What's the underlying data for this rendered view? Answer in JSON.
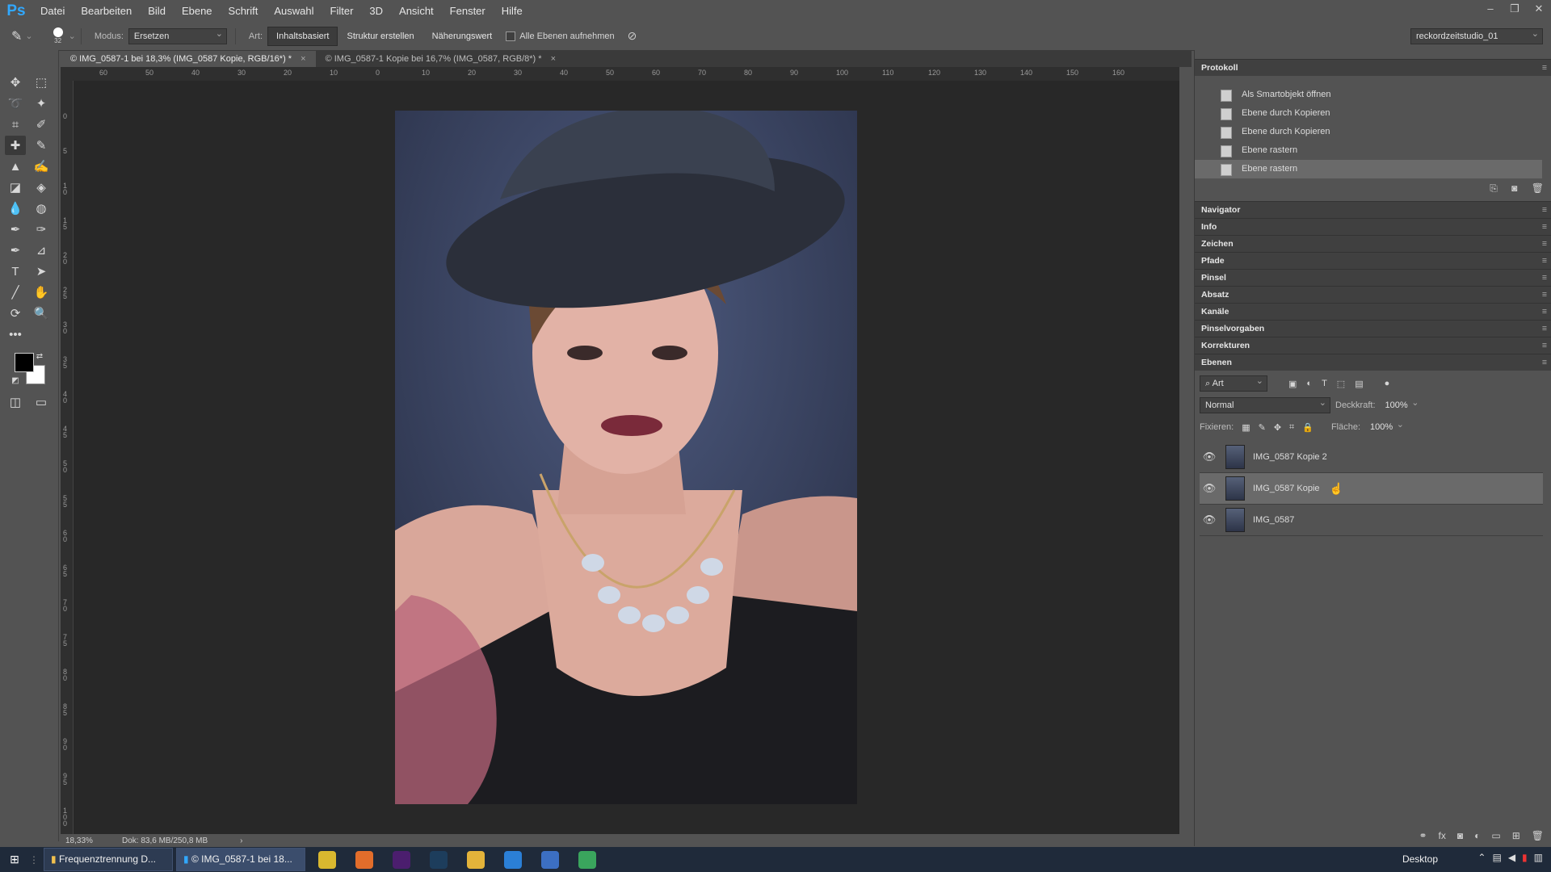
{
  "menubar": {
    "logo": "Ps",
    "items": [
      "Datei",
      "Bearbeiten",
      "Bild",
      "Ebene",
      "Schrift",
      "Auswahl",
      "Filter",
      "3D",
      "Ansicht",
      "Fenster",
      "Hilfe"
    ]
  },
  "options": {
    "brush_size": "32",
    "modus_label": "Modus:",
    "modus_value": "Ersetzen",
    "art_label": "Art:",
    "btn1": "Inhaltsbasiert",
    "btn2": "Struktur erstellen",
    "btn3": "Näherungswert",
    "all_layers": "Alle Ebenen aufnehmen",
    "workspace": "reckordzeitstudio_01"
  },
  "tabs": [
    {
      "label": "© IMG_0587-1 bei 18,3% (IMG_0587 Kopie, RGB/16*) *",
      "close": "×"
    },
    {
      "label": "© IMG_0587-1 Kopie bei 16,7% (IMG_0587, RGB/8*) *",
      "close": "×"
    }
  ],
  "ruler_top": [
    "60",
    "50",
    "40",
    "30",
    "20",
    "10",
    "0",
    "10",
    "20",
    "30",
    "40",
    "50",
    "60",
    "70",
    "80",
    "90",
    "100",
    "110",
    "120",
    "130",
    "140",
    "150",
    "160"
  ],
  "ruler_left": [
    "0",
    "5",
    "1\n0",
    "1\n5",
    "2\n0",
    "2\n5",
    "3\n0",
    "3\n5",
    "4\n0",
    "4\n5",
    "5\n0",
    "5\n5",
    "6\n0",
    "6\n5",
    "7\n0",
    "7\n5",
    "8\n0",
    "8\n5",
    "9\n0",
    "9\n5",
    "1\n0\n0"
  ],
  "status": {
    "zoom": "18,33%",
    "doc": "Dok: 83,6 MB/250,8 MB",
    "arrow": "›"
  },
  "history": {
    "title": "Protokoll",
    "items": [
      "Als Smartobjekt öffnen",
      "Ebene durch Kopieren",
      "Ebene durch Kopieren",
      "Ebene rastern",
      "Ebene rastern"
    ]
  },
  "collapsed_panels": [
    "Navigator",
    "Info",
    "Zeichen",
    "Pfade",
    "Pinsel",
    "Absatz",
    "Kanäle",
    "Pinselvorgaben",
    "Korrekturen"
  ],
  "layers": {
    "title": "Ebenen",
    "filter": "Art",
    "blend": "Normal",
    "opacity_label": "Deckkraft:",
    "opacity": "100%",
    "lock_label": "Fixieren:",
    "fill_label": "Fläche:",
    "fill": "100%",
    "items": [
      "IMG_0587 Kopie 2",
      "IMG_0587 Kopie",
      "IMG_0587"
    ]
  },
  "taskbar": {
    "items": [
      "Frequenztrennung D...",
      "© IMG_0587-1 bei 18..."
    ],
    "desktop": "Desktop"
  }
}
